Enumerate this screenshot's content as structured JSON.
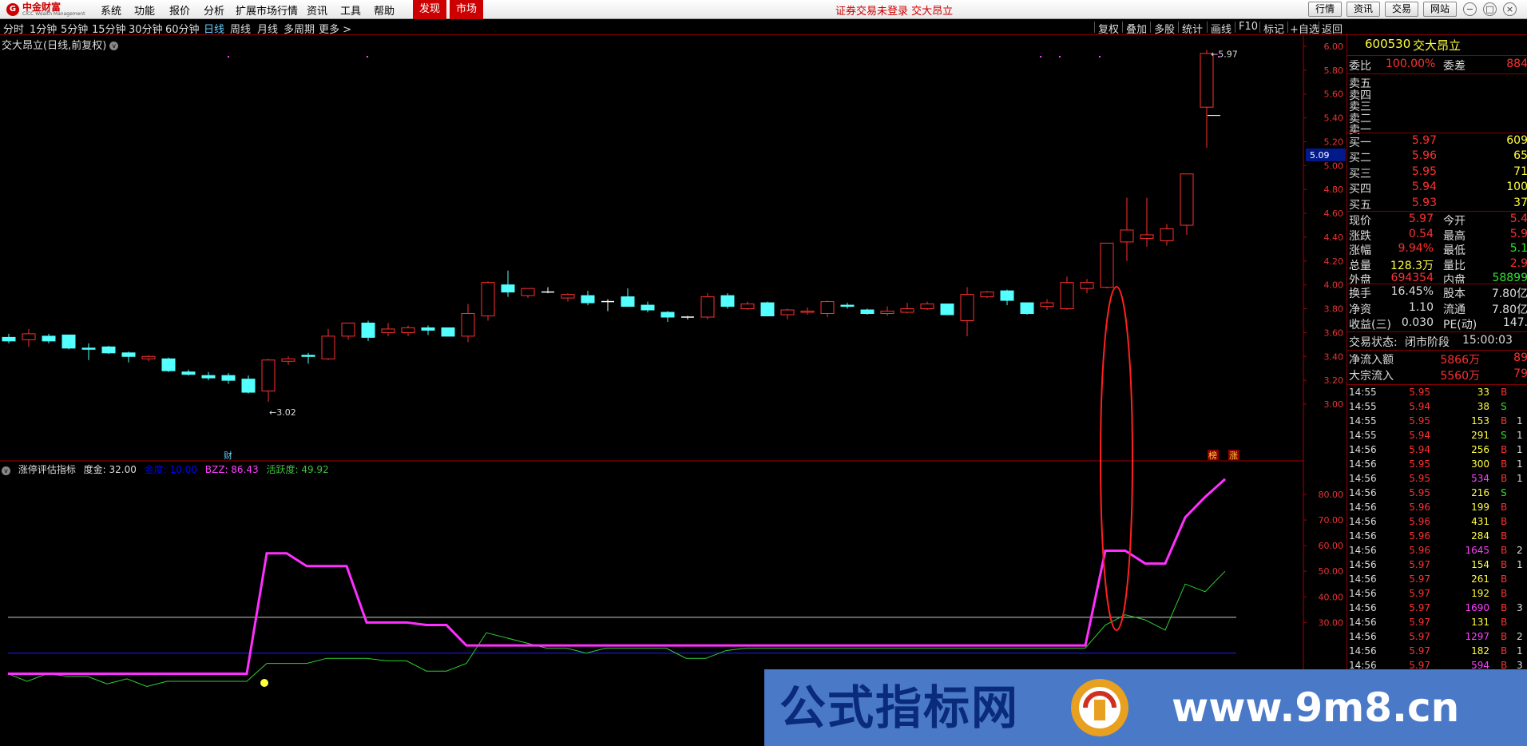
{
  "menubar": {
    "logo_text": "中金财富",
    "logo_sub": "CICC Wealth Management",
    "items": [
      "系统",
      "功能",
      "报价",
      "分析",
      "扩展市场行情",
      "资讯",
      "工具",
      "帮助"
    ],
    "tabs": [
      "发现",
      "市场"
    ],
    "notice": "证券交易未登录  交大昂立",
    "buttons": [
      "行情",
      "资讯",
      "交易",
      "网站"
    ]
  },
  "toolbar": {
    "periods": [
      "分时",
      "1分钟",
      "5分钟",
      "15分钟",
      "30分钟",
      "60分钟",
      "日线",
      "周线",
      "月线",
      "多周期",
      "更多 >"
    ],
    "active_period": "日线",
    "right_items": [
      "复权",
      "叠加",
      "多股",
      "统计",
      "画线",
      "F10",
      "标记",
      "+自选",
      "返回"
    ]
  },
  "chart": {
    "title": "交大昂立(日线,前复权)",
    "high_label": "5.97",
    "low_label": "3.02",
    "current_price_tag": "5.09",
    "fin_label": "财",
    "badges": [
      "榜",
      "涨"
    ],
    "axis_labels": [
      "6.00",
      "5.80",
      "5.60",
      "5.40",
      "5.20",
      "5.00",
      "4.80",
      "4.60",
      "4.40",
      "4.20",
      "4.00",
      "3.80",
      "3.60",
      "3.40",
      "3.20",
      "3.00"
    ],
    "ohlc": [
      [
        3.56,
        3.59,
        3.51,
        3.53
      ],
      [
        3.54,
        3.63,
        3.48,
        3.59
      ],
      [
        3.57,
        3.59,
        3.51,
        3.53
      ],
      [
        3.58,
        3.58,
        3.46,
        3.47
      ],
      [
        3.47,
        3.51,
        3.37,
        3.46
      ],
      [
        3.48,
        3.49,
        3.42,
        3.43
      ],
      [
        3.43,
        3.44,
        3.35,
        3.4
      ],
      [
        3.38,
        3.41,
        3.36,
        3.4
      ],
      [
        3.38,
        3.39,
        3.27,
        3.28
      ],
      [
        3.27,
        3.29,
        3.24,
        3.25
      ],
      [
        3.24,
        3.27,
        3.2,
        3.22
      ],
      [
        3.24,
        3.26,
        3.17,
        3.2
      ],
      [
        3.21,
        3.24,
        3.09,
        3.1
      ],
      [
        3.11,
        3.38,
        3.02,
        3.37
      ],
      [
        3.36,
        3.4,
        3.33,
        3.38
      ],
      [
        3.41,
        3.43,
        3.34,
        3.4
      ],
      [
        3.38,
        3.63,
        3.37,
        3.57
      ],
      [
        3.57,
        3.68,
        3.54,
        3.68
      ],
      [
        3.68,
        3.7,
        3.53,
        3.56
      ],
      [
        3.6,
        3.68,
        3.57,
        3.63
      ],
      [
        3.6,
        3.66,
        3.57,
        3.64
      ],
      [
        3.64,
        3.66,
        3.58,
        3.62
      ],
      [
        3.64,
        3.64,
        3.57,
        3.57
      ],
      [
        3.57,
        3.84,
        3.52,
        3.76
      ],
      [
        3.74,
        4.03,
        3.7,
        4.02
      ],
      [
        4.0,
        4.12,
        3.9,
        3.94
      ],
      [
        3.91,
        3.97,
        3.89,
        3.97
      ],
      [
        3.94,
        3.98,
        3.93,
        3.94
      ],
      [
        3.89,
        3.93,
        3.86,
        3.92
      ],
      [
        3.91,
        3.95,
        3.83,
        3.85
      ],
      [
        3.86,
        3.88,
        3.78,
        3.86
      ],
      [
        3.9,
        3.97,
        3.82,
        3.82
      ],
      [
        3.83,
        3.86,
        3.77,
        3.79
      ],
      [
        3.77,
        3.78,
        3.69,
        3.73
      ],
      [
        3.73,
        3.74,
        3.71,
        3.73
      ],
      [
        3.73,
        3.93,
        3.71,
        3.9
      ],
      [
        3.91,
        3.93,
        3.8,
        3.82
      ],
      [
        3.8,
        3.86,
        3.79,
        3.84
      ],
      [
        3.85,
        3.86,
        3.74,
        3.74
      ],
      [
        3.75,
        3.8,
        3.71,
        3.79
      ],
      [
        3.77,
        3.81,
        3.75,
        3.78
      ],
      [
        3.76,
        3.87,
        3.73,
        3.86
      ],
      [
        3.83,
        3.85,
        3.8,
        3.82
      ],
      [
        3.79,
        3.8,
        3.75,
        3.76
      ],
      [
        3.76,
        3.82,
        3.74,
        3.78
      ],
      [
        3.77,
        3.85,
        3.76,
        3.8
      ],
      [
        3.8,
        3.86,
        3.79,
        3.84
      ],
      [
        3.84,
        3.84,
        3.75,
        3.75
      ],
      [
        3.7,
        3.98,
        3.57,
        3.92
      ],
      [
        3.9,
        3.95,
        3.89,
        3.94
      ],
      [
        3.95,
        3.96,
        3.83,
        3.87
      ],
      [
        3.85,
        3.85,
        3.75,
        3.76
      ],
      [
        3.82,
        3.88,
        3.79,
        3.85
      ],
      [
        3.8,
        4.07,
        3.79,
        4.02
      ],
      [
        3.97,
        4.05,
        3.93,
        4.02
      ],
      [
        3.98,
        4.35,
        3.97,
        4.35
      ],
      [
        4.36,
        4.73,
        4.2,
        4.46
      ],
      [
        4.39,
        4.73,
        4.32,
        4.42
      ],
      [
        4.37,
        4.51,
        4.33,
        4.47
      ],
      [
        4.5,
        4.93,
        4.42,
        4.93
      ],
      [
        5.49,
        5.97,
        5.15,
        5.94
      ]
    ]
  },
  "indicator": {
    "name": "涨停评估指标",
    "params": [
      {
        "label": "度金: 32.00",
        "color": "#ddd"
      },
      {
        "label": "金度: 10.00",
        "color": "#0000ff"
      },
      {
        "label": "BZZ: 86.43",
        "color": "#ff40ff"
      },
      {
        "label": "活跃度: 49.92",
        "color": "#40c040"
      }
    ],
    "axis_labels": [
      "80.00",
      "70.00",
      "60.00",
      "50.00",
      "40.00",
      "30.00"
    ],
    "bzz": [
      10,
      10,
      10,
      10,
      10,
      10,
      10,
      10,
      10,
      10,
      10,
      10,
      10,
      57,
      57,
      52,
      52,
      52,
      30,
      30,
      30,
      29,
      29,
      21,
      21,
      21,
      21,
      21,
      21,
      21,
      21,
      21,
      21,
      21,
      21,
      21,
      21,
      21,
      21,
      21,
      21,
      21,
      21,
      21,
      21,
      21,
      21,
      21,
      21,
      21,
      21,
      21,
      21,
      21,
      21,
      58,
      58,
      53,
      53,
      71,
      79,
      86
    ],
    "huoyue": [
      10,
      7,
      10,
      9,
      9,
      6,
      8,
      5,
      7,
      7,
      7,
      7,
      7,
      14,
      14,
      14,
      16,
      16,
      16,
      15,
      15,
      11,
      11,
      14,
      26,
      24,
      22,
      20,
      20,
      18,
      20,
      20,
      20,
      20,
      16,
      16,
      19,
      20,
      20,
      20,
      20,
      20,
      20,
      20,
      20,
      20,
      20,
      20,
      20,
      20,
      20,
      20,
      20,
      20,
      20,
      29,
      33,
      31,
      27,
      45,
      42,
      50
    ],
    "line_white": 32,
    "line_blue": 18
  },
  "panel": {
    "code": "600530",
    "name": "交大昂立",
    "weibi_label": "委比",
    "weibi": "100.00%",
    "weicha_label": "委差",
    "weicha": "884",
    "sell": [
      {
        "label": "卖五",
        "price": "",
        "vol": ""
      },
      {
        "label": "卖四",
        "price": "",
        "vol": ""
      },
      {
        "label": "卖三",
        "price": "",
        "vol": ""
      },
      {
        "label": "卖二",
        "price": "",
        "vol": ""
      },
      {
        "label": "卖一",
        "price": "",
        "vol": ""
      }
    ],
    "buy": [
      {
        "label": "买一",
        "price": "5.97",
        "vol": "609"
      },
      {
        "label": "买二",
        "price": "5.96",
        "vol": "65"
      },
      {
        "label": "买三",
        "price": "5.95",
        "vol": "71"
      },
      {
        "label": "买四",
        "price": "5.94",
        "vol": "100"
      },
      {
        "label": "买五",
        "price": "5.93",
        "vol": "37"
      }
    ],
    "quote": [
      {
        "l1": "现价",
        "v1": "5.97",
        "c1": "red",
        "l2": "今开",
        "v2": "5.4",
        "c2": "red"
      },
      {
        "l1": "涨跌",
        "v1": "0.54",
        "c1": "red",
        "l2": "最高",
        "v2": "5.9",
        "c2": "red"
      },
      {
        "l1": "涨幅",
        "v1": "9.94%",
        "c1": "red",
        "l2": "最低",
        "v2": "5.1",
        "c2": "green"
      },
      {
        "l1": "总量",
        "v1": "128.3万",
        "c1": "yellow",
        "l2": "量比",
        "v2": "2.9",
        "c2": "red"
      },
      {
        "l1": "外盘",
        "v1": "694354",
        "c1": "red",
        "l2": "内盘",
        "v2": "58899",
        "c2": "green"
      }
    ],
    "stats": [
      {
        "l1": "换手",
        "v1": "16.45%",
        "l2": "股本",
        "v2": "7.80亿"
      },
      {
        "l1": "净资",
        "v1": "1.10",
        "l2": "流通",
        "v2": "7.80亿"
      },
      {
        "l1": "收益(三)",
        "v1": "0.030",
        "l2": "PE(动)",
        "v2": "147."
      }
    ],
    "status_label": "交易状态:",
    "status_value": "闭市阶段",
    "status_time": "15:00:03",
    "flows": [
      {
        "label": "净流入额",
        "value": "5866万",
        "extra": "89"
      },
      {
        "label": "大宗流入",
        "value": "5560万",
        "extra": "79"
      }
    ],
    "ticks": [
      {
        "t": "14:55",
        "p": "5.95",
        "v": "33",
        "bs": "B",
        "n": ""
      },
      {
        "t": "14:55",
        "p": "5.94",
        "v": "38",
        "bs": "S",
        "n": ""
      },
      {
        "t": "14:55",
        "p": "5.95",
        "v": "153",
        "bs": "B",
        "n": "1"
      },
      {
        "t": "14:55",
        "p": "5.94",
        "v": "291",
        "bs": "S",
        "n": "1"
      },
      {
        "t": "14:56",
        "p": "5.94",
        "v": "256",
        "bs": "B",
        "n": "1"
      },
      {
        "t": "14:56",
        "p": "5.95",
        "v": "300",
        "bs": "B",
        "n": "1"
      },
      {
        "t": "14:56",
        "p": "5.95",
        "v": "534",
        "bs": "B",
        "n": "1"
      },
      {
        "t": "14:56",
        "p": "5.95",
        "v": "216",
        "bs": "S",
        "n": ""
      },
      {
        "t": "14:56",
        "p": "5.96",
        "v": "199",
        "bs": "B",
        "n": ""
      },
      {
        "t": "14:56",
        "p": "5.96",
        "v": "431",
        "bs": "B",
        "n": ""
      },
      {
        "t": "14:56",
        "p": "5.96",
        "v": "284",
        "bs": "B",
        "n": ""
      },
      {
        "t": "14:56",
        "p": "5.96",
        "v": "1645",
        "bs": "B",
        "n": "2"
      },
      {
        "t": "14:56",
        "p": "5.97",
        "v": "154",
        "bs": "B",
        "n": "1"
      },
      {
        "t": "14:56",
        "p": "5.97",
        "v": "261",
        "bs": "B",
        "n": ""
      },
      {
        "t": "14:56",
        "p": "5.97",
        "v": "192",
        "bs": "B",
        "n": ""
      },
      {
        "t": "14:56",
        "p": "5.97",
        "v": "1690",
        "bs": "B",
        "n": "3"
      },
      {
        "t": "14:56",
        "p": "5.97",
        "v": "131",
        "bs": "B",
        "n": ""
      },
      {
        "t": "14:56",
        "p": "5.97",
        "v": "1297",
        "bs": "B",
        "n": "2"
      },
      {
        "t": "14:56",
        "p": "5.97",
        "v": "182",
        "bs": "B",
        "n": "1"
      },
      {
        "t": "14:56",
        "p": "5.97",
        "v": "594",
        "bs": "B",
        "n": "3"
      }
    ]
  },
  "watermark": {
    "text": "公式指标网",
    "url": "www.9m8.cn"
  }
}
